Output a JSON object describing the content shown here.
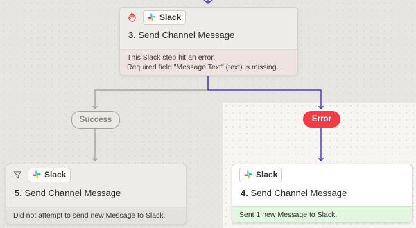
{
  "colors": {
    "canvas": "#e7e5e1",
    "spotlight": "#f7f6f3",
    "active_wire": "#4b3fbf",
    "inactive_wire": "#a9a6a1",
    "error_pill": "#ef3e46",
    "success_status": "#e3f6df"
  },
  "top_card": {
    "icon": "hand-stop-icon",
    "app": "Slack",
    "step_number": "3.",
    "step_title": "Send Channel Message",
    "status_line1": "This Slack step hit an error.",
    "status_line2": "Required field \"Message Text\" (text) is missing."
  },
  "branches": {
    "success_label": "Success",
    "error_label": "Error"
  },
  "left_card": {
    "icon": "filter-icon",
    "app": "Slack",
    "step_number": "5.",
    "step_title": "Send Channel Message",
    "status": "Did not attempt to send new Message to Slack."
  },
  "right_card": {
    "app": "Slack",
    "step_number": "4.",
    "step_title": "Send Channel Message",
    "status": "Sent 1 new Message to Slack."
  }
}
